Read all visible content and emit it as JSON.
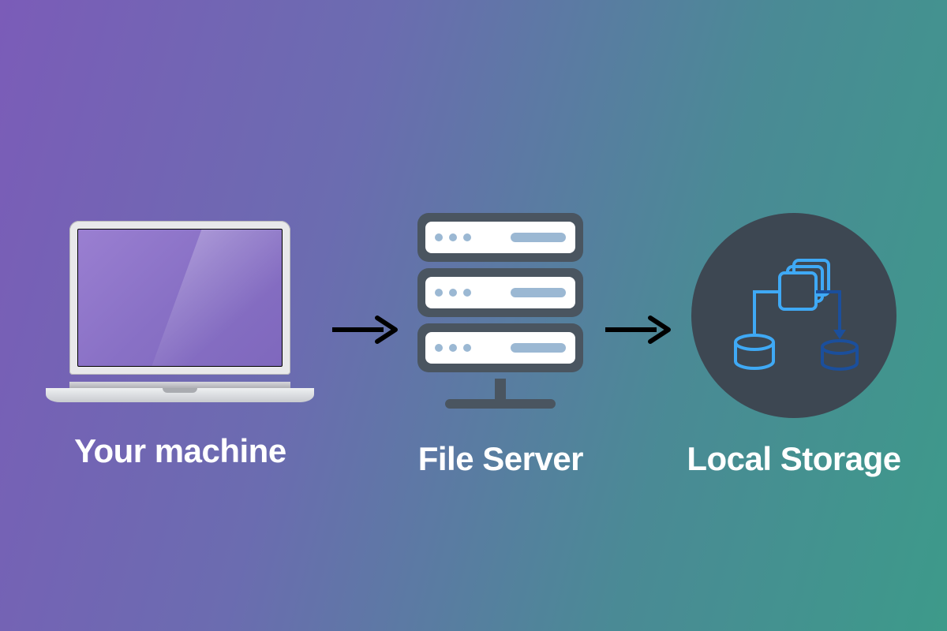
{
  "nodes": {
    "machine": {
      "label": "Your machine",
      "icon": "laptop"
    },
    "server": {
      "label": "File Server",
      "icon": "server-rack"
    },
    "storage": {
      "label": "Local Storage",
      "icon": "storage-distribution"
    }
  },
  "flow": [
    "machine",
    "server",
    "storage"
  ],
  "colors": {
    "bg_gradient_left": "#7b5cb8",
    "bg_gradient_right": "#3d9a8a",
    "server_frame": "#4a5560",
    "server_accent": "#9bb8d3",
    "storage_bg": "#3d4752",
    "storage_light": "#3fa9f5",
    "storage_dark": "#1b4f9c",
    "label_text": "#ffffff"
  }
}
